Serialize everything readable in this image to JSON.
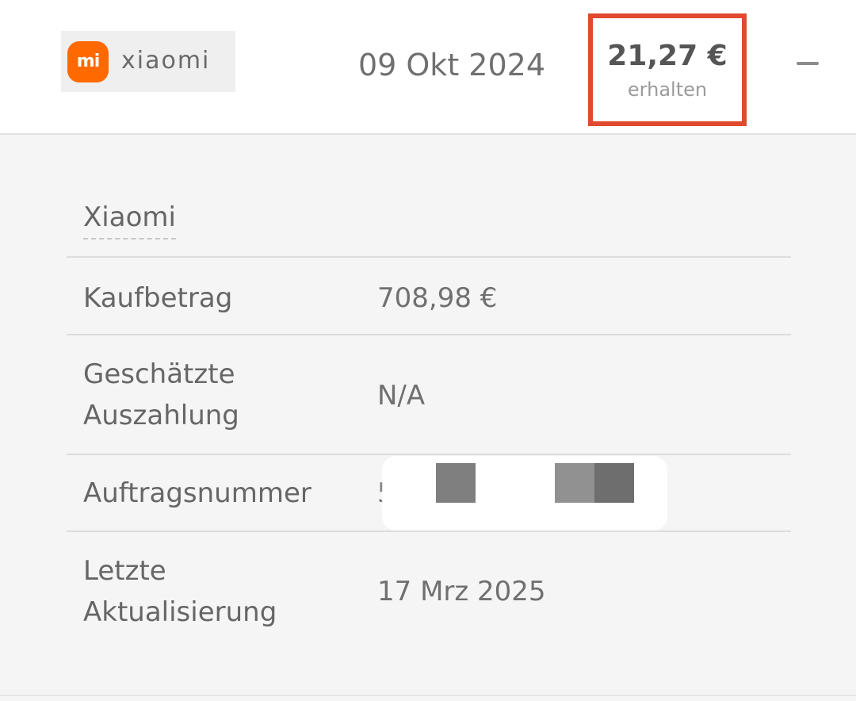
{
  "header": {
    "logo_mark": "mi",
    "logo_word": "xiaomi",
    "date": "09 Okt 2024",
    "amount": "21,27 €",
    "amount_status": "erhalten",
    "collapse_icon": "minus-icon"
  },
  "details": {
    "merchant": "Xiaomi",
    "rows": [
      {
        "label": "Kaufbetrag",
        "value": "708,98 €"
      },
      {
        "label_lines": [
          "Geschätzte",
          "Auszahlung"
        ],
        "value": "N/A"
      },
      {
        "label": "Auftragsnummer",
        "value": "5"
      },
      {
        "label_lines": [
          "Letzte",
          "Aktualisierung"
        ],
        "value": "17 Mrz 2025"
      }
    ]
  },
  "colors": {
    "highlight_border": "#e04a2f",
    "brand_orange": "#ff6900",
    "panel_bg": "#f5f5f5"
  }
}
